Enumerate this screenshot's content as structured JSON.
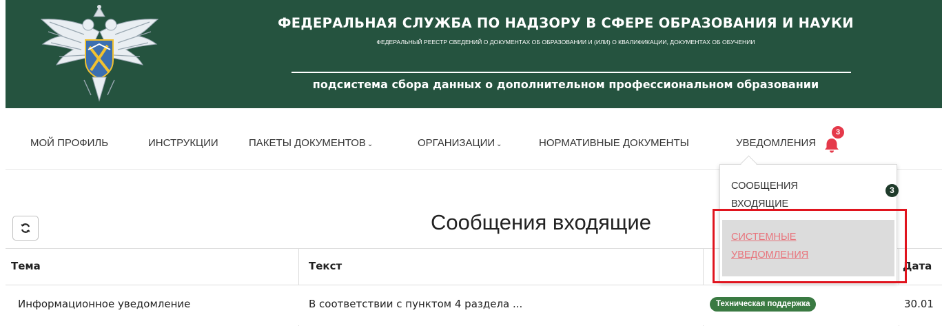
{
  "header": {
    "title": "ФЕДЕРАЛЬНАЯ СЛУЖБА ПО НАДЗОРУ В СФЕРЕ ОБРАЗОВАНИЯ И НАУКИ",
    "subtitle": "ФЕДЕРАЛЬНЫЙ РЕЕСТР СВЕДЕНИЙ О ДОКУМЕНТАХ ОБ ОБРАЗОВАНИИ И (ИЛИ) О КВАЛИФИКАЦИИ, ДОКУМЕНТАХ ОБ ОБУЧЕНИИ",
    "subsystem": "подсистема сбора данных о дополнительном профессиональном образовании",
    "emblem_icon": "double-headed-eagle-emblem"
  },
  "nav": {
    "items": [
      {
        "label": "МОЙ ПРОФИЛЬ"
      },
      {
        "label": "ИНСТРУКЦИИ"
      },
      {
        "label": "ПАКЕТЫ ДОКУМЕНТОВ",
        "caret": "⌄"
      },
      {
        "label": "ОРГАНИЗАЦИИ",
        "caret": "⌄"
      },
      {
        "label": "НОРМАТИВНЫЕ ДОКУМЕНТЫ"
      },
      {
        "label": "УВЕДОМЛЕНИЯ"
      }
    ],
    "notification_count": "3",
    "bell_icon": "bell-icon"
  },
  "dropdown": {
    "inbox_label": "СООБЩЕНИЯ ВХОДЯЩИЕ",
    "inbox_count": "3",
    "system_label": "СИСТЕМНЫЕ УВЕДОМЛЕНИЯ"
  },
  "content": {
    "refresh_icon": "refresh-icon",
    "page_title": "Сообщения входящие",
    "columns": [
      "Тема",
      "Текст",
      "",
      "Дата"
    ],
    "rows": [
      {
        "topic": "Информационное уведомление",
        "text": "В соответствии с пунктом 4 раздела ...",
        "sender_tag": "Техническая поддержка",
        "date": "30.01"
      }
    ]
  },
  "colors": {
    "header_bg": "#25533f",
    "badge_red": "#e5394a",
    "tag_green": "#3a7a42",
    "highlight_frame": "#e0141e",
    "link_pink": "#e8747c"
  }
}
